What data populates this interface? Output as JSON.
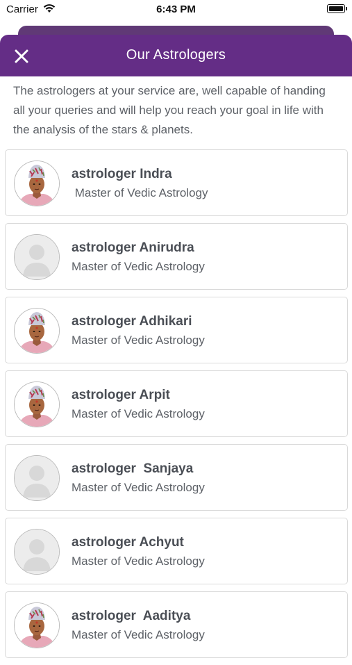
{
  "status_bar": {
    "carrier": "Carrier",
    "time": "6:43 PM"
  },
  "header": {
    "title": "Our Astrologers"
  },
  "intro": "The astrologers at your service are, well capable of handing all your queries and will help you reach your goal in life with the analysis of the stars & planets.",
  "astrologers": [
    {
      "name": "astrologer Indra",
      "title": " Master of Vedic Astrology",
      "avatar": "photo"
    },
    {
      "name": "astrologer Anirudra",
      "title": "Master of Vedic Astrology",
      "avatar": "placeholder"
    },
    {
      "name": "astrologer Adhikari",
      "title": "Master of Vedic Astrology",
      "avatar": "photo"
    },
    {
      "name": "astrologer Arpit",
      "title": "Master of Vedic Astrology",
      "avatar": "photo"
    },
    {
      "name": "astrologer  Sanjaya",
      "title": "Master of Vedic Astrology",
      "avatar": "placeholder"
    },
    {
      "name": "astrologer Achyut",
      "title": "Master of Vedic Astrology",
      "avatar": "placeholder"
    },
    {
      "name": "astrologer  Aaditya",
      "title": "Master of Vedic Astrology",
      "avatar": "photo"
    }
  ],
  "colors": {
    "header": "#642d86",
    "header_back": "#4f2467",
    "card_border": "#d9d9d9"
  }
}
